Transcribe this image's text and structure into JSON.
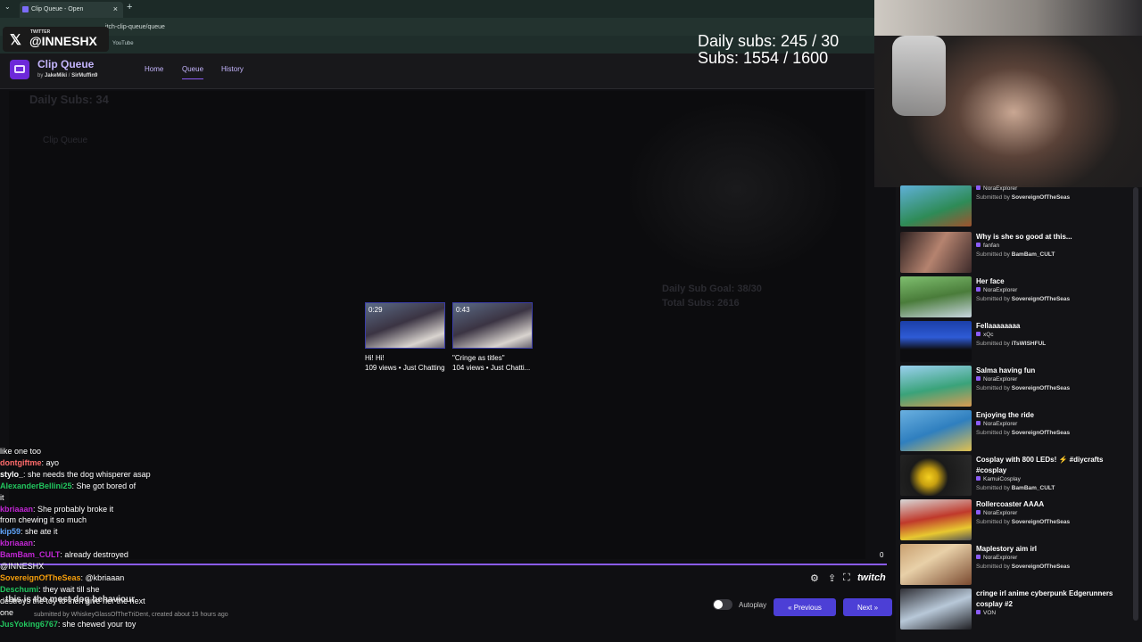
{
  "browser": {
    "tab_title": "Clip Queue - Open",
    "url": "itch-clip-queue/queue",
    "bookmark": "YouTube"
  },
  "overlay": {
    "twitter_label": "TWITTER",
    "twitter_handle": "@INNESHX",
    "daily_subs": "Daily subs: 245 / 30",
    "subs": "Subs: 1554 / 1600"
  },
  "app": {
    "title": "Clip Queue",
    "by": "by",
    "author1": "JakeMiki",
    "author2": "SirMuffin9",
    "nav": {
      "home": "Home",
      "queue": "Queue",
      "history": "History"
    }
  },
  "ghost": {
    "daily_subs": "Daily Subs: 34",
    "title": "Clip Queue",
    "goal": "Daily Sub Goal: 38/30",
    "total": "Total Subs: 2616"
  },
  "player": {
    "time": "0",
    "brand": "twitch"
  },
  "cards": [
    {
      "duration": "0:29",
      "title": "Hi! Hi!",
      "meta": "109 views • Just Chatting"
    },
    {
      "duration": "0:43",
      "title": "\"Cringe as titles\"",
      "meta": "104 views • Just Chatti..."
    }
  ],
  "controls": {
    "autoplay": "Autoplay",
    "previous": "Previous",
    "next": "Next"
  },
  "clip_info": {
    "title": "this is the most dog behaviour",
    "submitted": "submitted by WhiskeyGlassOfTheTriDent, created about 15 hours ago"
  },
  "chat": [
    {
      "user": "",
      "color": "#ffffff",
      "text": "like one too"
    },
    {
      "user": "dontgiftme",
      "color": "#ff6b6b",
      "text": ": ayo"
    },
    {
      "user": "stylo_",
      "color": "#ffffff",
      "text": ": she needs the dog whisperer asap"
    },
    {
      "user": "AlexanderBellini25",
      "color": "#22c55e",
      "text": ": She got bored of"
    },
    {
      "user": "",
      "color": "#ffffff",
      "text": "it"
    },
    {
      "user": "kbriaaan",
      "color": "#c026d3",
      "text": ": She probably broke it"
    },
    {
      "user": "",
      "color": "#ffffff",
      "text": "from chewing it so much"
    },
    {
      "user": "kip59",
      "color": "#60a5fa",
      "text": ": she ate it"
    },
    {
      "user": "kbriaaan",
      "color": "#c026d3",
      "text": ":"
    },
    {
      "user": "BamBam_CULT",
      "color": "#c026d3",
      "text": ": already destroyed"
    },
    {
      "user": "",
      "color": "#ffffff",
      "text": "@INNESHX"
    },
    {
      "user": "SovereignOfTheSeas",
      "color": "#f59e0b",
      "text": ": @kbriaaan"
    },
    {
      "user": "Deschumi",
      "color": "#22c55e",
      "text": ": they wait till she"
    },
    {
      "user": "",
      "color": "#ffffff",
      "text": "destroys the toy to then give her the next"
    },
    {
      "user": "",
      "color": "#ffffff",
      "text": "one"
    },
    {
      "user": "JusYoking6767",
      "color": "#22c55e",
      "text": ": she chewed your toy"
    }
  ],
  "queue": [
    {
      "title": "",
      "author": "NoraExplorer",
      "submitter": "SovereignOfTheSeas",
      "thumb": "linear-gradient(160deg,#5fb0d8,#2e8b57 60%,#a0522d)"
    },
    {
      "title": "Why is she so good at this...",
      "author": "fanfan",
      "submitter": "BamBam_CULT",
      "thumb": "linear-gradient(120deg,#2b1f1f,#b5836f 50%,#3d2a2a)"
    },
    {
      "title": "Her face",
      "author": "NoraExplorer",
      "submitter": "SovereignOfTheSeas",
      "thumb": "linear-gradient(170deg,#7fbf6f,#4a7c3a 50%,#c9d6e0)"
    },
    {
      "title": "Fellaaaaaaaa",
      "author": "xQc",
      "submitter": "iTsWISHFUL",
      "thumb": "linear-gradient(180deg,#1b3fa8,#2e5bd6 40%,#0d0d10 70%)"
    },
    {
      "title": "Salma having fun",
      "author": "NoraExplorer",
      "submitter": "SovereignOfTheSeas",
      "thumb": "linear-gradient(170deg,#9bd0f0,#3aa37a 55%,#d99b52)"
    },
    {
      "title": "Enjoying the ride",
      "author": "NoraExplorer",
      "submitter": "SovereignOfTheSeas",
      "thumb": "linear-gradient(160deg,#6ab0e0,#2f7fbf 50%,#e0c050)"
    },
    {
      "title": "Cosplay with 800 LEDs! ⚡ #diycrafts #cosplay",
      "author": "KamuiCosplay",
      "submitter": "BamBam_CULT",
      "thumb": "radial-gradient(circle at 40% 55%,#f5d020 0%,#c8a010 18%,#1a1a1a 40%,#2a2a2a 100%)"
    },
    {
      "title": "Rollercoaster AAAA",
      "author": "NoraExplorer",
      "submitter": "SovereignOfTheSeas",
      "thumb": "linear-gradient(170deg,#d8d8d8,#c0392b 45%,#e8c830 75%,#555)"
    },
    {
      "title": "Maplestory aim irl",
      "author": "NoraExplorer",
      "submitter": "SovereignOfTheSeas",
      "thumb": "linear-gradient(150deg,#c9a070,#e8d0a8 40%,#7a4a30)"
    },
    {
      "title": "cringe irl anime cyberpunk Edgerunners cosplay #2",
      "author": "VON",
      "submitter": "",
      "thumb": "linear-gradient(160deg,#303036,#b8c8d8 50%,#202024)"
    }
  ],
  "submitted_by_label": "Submitted by"
}
